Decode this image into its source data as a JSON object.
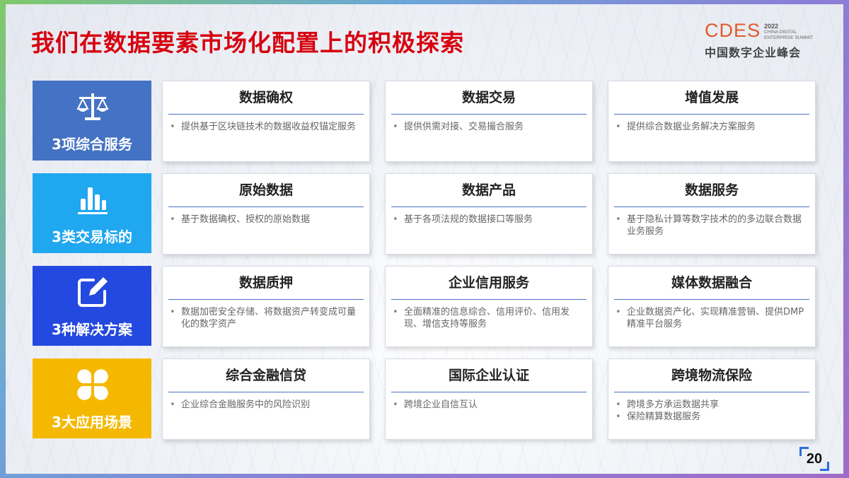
{
  "title": "我们在数据要素市场化配置上的积极探索",
  "logo": {
    "main": "CDES",
    "year": "2022",
    "sub_line1": "CHINA DIGITAL",
    "sub_line2": "ENTERPRISE SUMMIT",
    "cn": "中国数字企业峰会"
  },
  "rows": [
    {
      "label": "3项综合服务",
      "color": "#4472c4",
      "icon": "scale-icon",
      "cards": [
        {
          "title": "数据确权",
          "items": [
            "提供基于区块链技术的数据收益权锚定服务"
          ]
        },
        {
          "title": "数据交易",
          "items": [
            "提供供需对接、交易撮合服务"
          ]
        },
        {
          "title": "增值发展",
          "items": [
            "提供综合数据业务解决方案服务"
          ]
        }
      ]
    },
    {
      "label": "3类交易标的",
      "color": "#1fa7f0",
      "icon": "bar-chart-icon",
      "cards": [
        {
          "title": "原始数据",
          "items": [
            "基于数据确权、授权的原始数据"
          ]
        },
        {
          "title": "数据产品",
          "items": [
            "基于各项法规的数据接口等服务"
          ]
        },
        {
          "title": "数据服务",
          "items": [
            "基于隐私计算等数字技术的的多边联合数据业务服务"
          ]
        }
      ]
    },
    {
      "label": "3种解决方案",
      "color": "#2449e0",
      "icon": "edit-icon",
      "cards": [
        {
          "title": "数据质押",
          "items": [
            "数据加密安全存储、将数据资产转变成可量化的数字资产"
          ]
        },
        {
          "title": "企业信用服务",
          "items": [
            "全面精准的信息综合、信用评价、信用发现、增信支持等服务"
          ]
        },
        {
          "title": "媒体数据融合",
          "items": [
            "企业数据资产化、实现精准营销、提供DMP精准平台服务"
          ]
        }
      ]
    },
    {
      "label": "3大应用场景",
      "color": "#f5b800",
      "icon": "clover-icon",
      "cards": [
        {
          "title": "综合金融信贷",
          "items": [
            "企业综合金融服务中的风险识别"
          ]
        },
        {
          "title": "国际企业认证",
          "items": [
            "跨境企业自信互认"
          ]
        },
        {
          "title": "跨境物流保险",
          "items": [
            "跨境多方承运数据共享",
            "保险精算数据服务"
          ]
        }
      ]
    }
  ],
  "page_number": "20"
}
